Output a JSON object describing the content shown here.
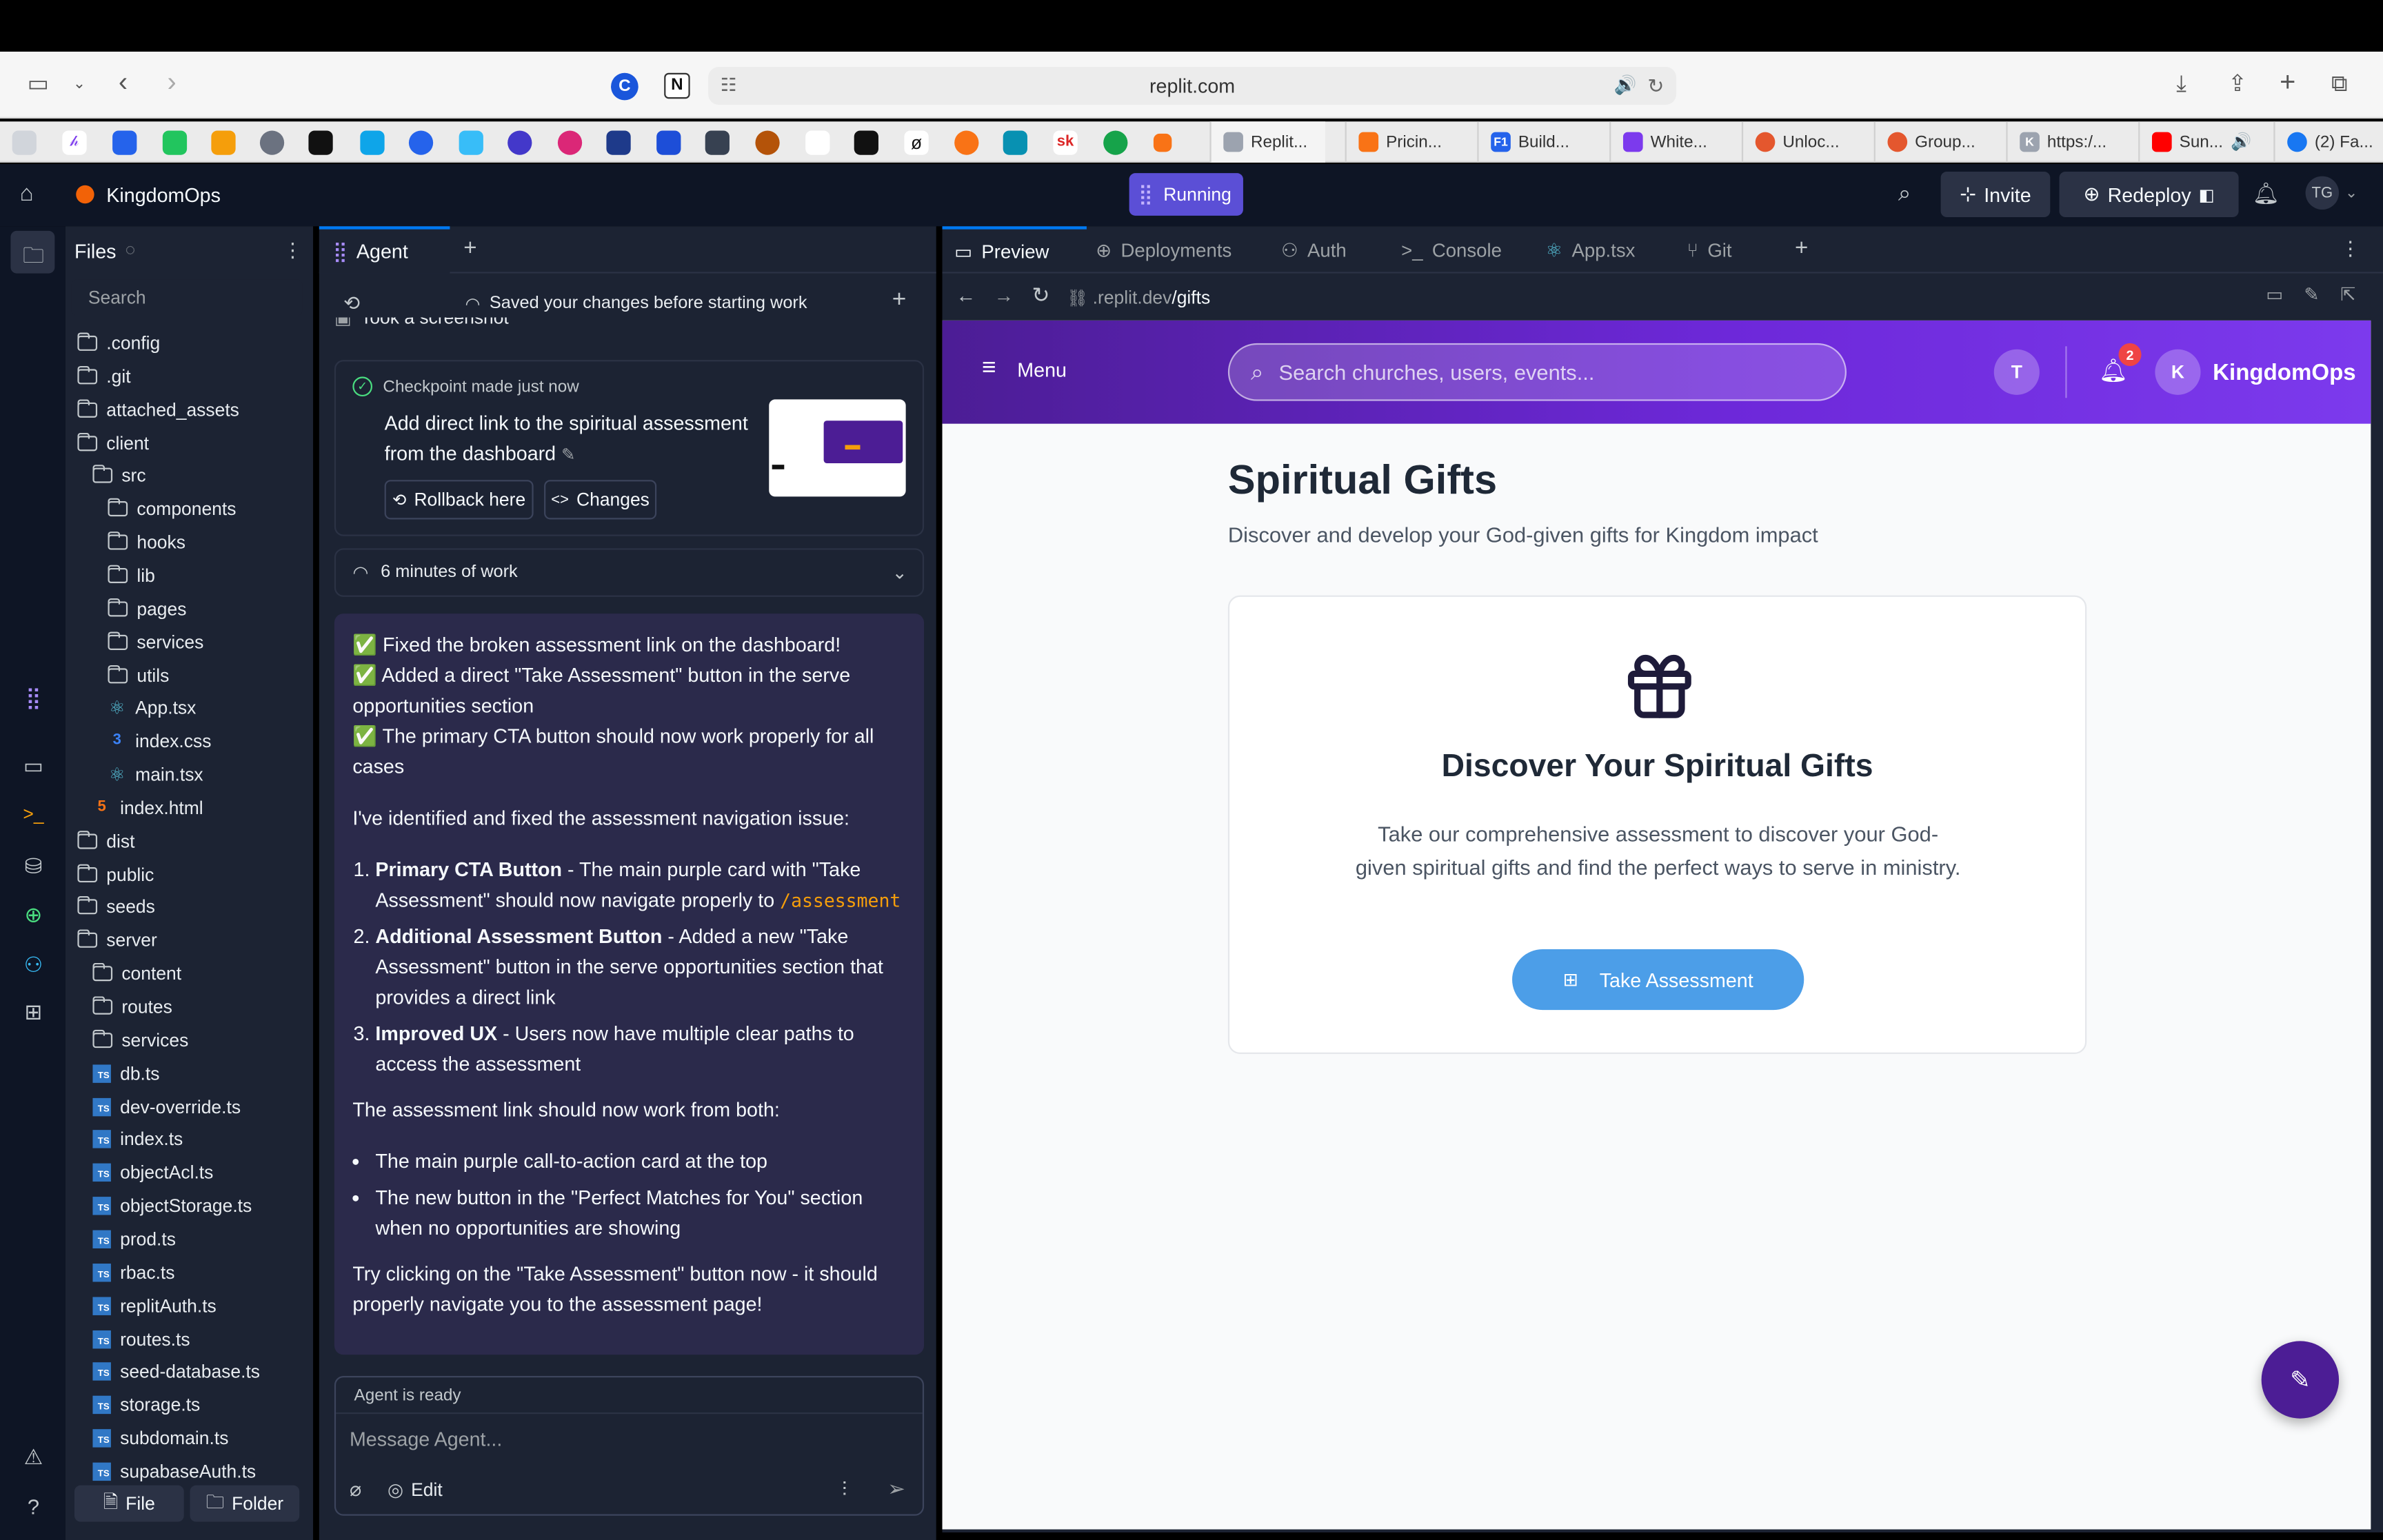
{
  "safari": {
    "url": "replit.com"
  },
  "tabs": [
    {
      "label": "Replit...",
      "color": "#f26207"
    },
    {
      "label": "Pricin...",
      "color": "#f97316"
    },
    {
      "label": "Build...",
      "color": "#2563eb",
      "glyph": "F1"
    },
    {
      "label": "White...",
      "color": "#7c3aed"
    },
    {
      "label": "Unloc...",
      "color": "#e4572e"
    },
    {
      "label": "Group...",
      "color": "#e4572e"
    },
    {
      "label": "https:/...",
      "color": "#9ca3af",
      "glyph": "K"
    },
    {
      "label": "Sun...",
      "color": "#ff0000"
    },
    {
      "label": "(2) Fa...",
      "color": "#1877f2"
    }
  ],
  "replit": {
    "project": "KingdomOps",
    "status": "Running",
    "invite": "Invite",
    "redeploy": "Redeploy",
    "avatar": "TG"
  },
  "files": {
    "title": "Files",
    "search_placeholder": "Search",
    "items": [
      {
        "name": ".config",
        "type": "folder",
        "indent": 0
      },
      {
        "name": ".git",
        "type": "folder",
        "indent": 0
      },
      {
        "name": "attached_assets",
        "type": "folder",
        "indent": 0
      },
      {
        "name": "client",
        "type": "folder",
        "indent": 0
      },
      {
        "name": "src",
        "type": "folder",
        "indent": 1
      },
      {
        "name": "components",
        "type": "folder",
        "indent": 2
      },
      {
        "name": "hooks",
        "type": "folder",
        "indent": 2
      },
      {
        "name": "lib",
        "type": "folder",
        "indent": 2
      },
      {
        "name": "pages",
        "type": "folder",
        "indent": 2
      },
      {
        "name": "services",
        "type": "folder",
        "indent": 2
      },
      {
        "name": "utils",
        "type": "folder",
        "indent": 2
      },
      {
        "name": "App.tsx",
        "type": "react",
        "indent": 2
      },
      {
        "name": "index.css",
        "type": "css",
        "indent": 2
      },
      {
        "name": "main.tsx",
        "type": "react",
        "indent": 2
      },
      {
        "name": "index.html",
        "type": "html",
        "indent": 1
      },
      {
        "name": "dist",
        "type": "folder",
        "indent": 0
      },
      {
        "name": "public",
        "type": "folder",
        "indent": 0
      },
      {
        "name": "seeds",
        "type": "folder",
        "indent": 0
      },
      {
        "name": "server",
        "type": "folder",
        "indent": 0
      },
      {
        "name": "content",
        "type": "folder",
        "indent": 1
      },
      {
        "name": "routes",
        "type": "folder",
        "indent": 1
      },
      {
        "name": "services",
        "type": "folder",
        "indent": 1
      },
      {
        "name": "db.ts",
        "type": "ts",
        "indent": 1
      },
      {
        "name": "dev-override.ts",
        "type": "ts",
        "indent": 1
      },
      {
        "name": "index.ts",
        "type": "ts",
        "indent": 1
      },
      {
        "name": "objectAcl.ts",
        "type": "ts",
        "indent": 1
      },
      {
        "name": "objectStorage.ts",
        "type": "ts",
        "indent": 1
      },
      {
        "name": "prod.ts",
        "type": "ts",
        "indent": 1
      },
      {
        "name": "rbac.ts",
        "type": "ts",
        "indent": 1
      },
      {
        "name": "replitAuth.ts",
        "type": "ts",
        "indent": 1
      },
      {
        "name": "routes.ts",
        "type": "ts",
        "indent": 1
      },
      {
        "name": "seed-database.ts",
        "type": "ts",
        "indent": 1
      },
      {
        "name": "storage.ts",
        "type": "ts",
        "indent": 1
      },
      {
        "name": "subdomain.ts",
        "type": "ts",
        "indent": 1
      },
      {
        "name": "supabaseAuth.ts",
        "type": "ts",
        "indent": 1
      }
    ],
    "new_file": "File",
    "new_folder": "Folder"
  },
  "agent": {
    "tab": "Agent",
    "saved_banner": "Saved your changes before starting work",
    "screenshot_line": "Took a screenshot",
    "checkpoint_label": "Checkpoint made just now",
    "checkpoint_title": "Add direct link to the spiritual assessment from the dashboard",
    "rollback": "Rollback here",
    "changes": "Changes",
    "work_time": "6 minutes of work",
    "checks": [
      "✅ Fixed the broken assessment link on the dashboard!",
      "✅ Added a direct \"Take Assessment\" button in the serve opportunities section",
      "✅ The primary CTA button should now work properly for all cases"
    ],
    "intro": "I've identified and fixed the assessment navigation issue:",
    "steps": [
      {
        "bold": "Primary CTA Button",
        "text": " - The main purple card with \"Take Assessment\" should now navigate properly to ",
        "code": "/assessment"
      },
      {
        "bold": "Additional Assessment Button",
        "text": " - Added a new \"Take Assessment\" button in the serve opportunities section that provides a direct link",
        "code": ""
      },
      {
        "bold": "Improved UX",
        "text": " - Users now have multiple clear paths to access the assessment",
        "code": ""
      }
    ],
    "both_line": "The assessment link should now work from both:",
    "bullets": [
      "The main purple call-to-action card at the top",
      "The new button in the \"Perfect Matches for You\" section when no opportunities are showing"
    ],
    "closing": "Try clicking on the \"Take Assessment\" button now - it should properly navigate you to the assessment page!",
    "ready": "Agent is ready",
    "input_placeholder": "Message Agent...",
    "edit": "Edit"
  },
  "preview": {
    "tabs": [
      "Preview",
      "Deployments",
      "Auth",
      "Console",
      "App.tsx",
      "Git"
    ],
    "url_host": ".replit.dev",
    "url_path": "/gifts"
  },
  "site": {
    "menu": "Menu",
    "search_placeholder": "Search churches, users, events...",
    "user_initial": "T",
    "notif_count": "2",
    "brand_initial": "K",
    "brand": "KingdomOps",
    "page_title": "Spiritual Gifts",
    "page_subtitle": "Discover and develop your God-given gifts for Kingdom impact",
    "card_title": "Discover Your Spiritual Gifts",
    "card_text": "Take our comprehensive assessment to discover your God-given spiritual gifts and find the perfect ways to serve in ministry.",
    "cta": "Take Assessment"
  },
  "colors": {
    "accent": "#7c3aed",
    "cta": "#4c9ee8",
    "replit_bg": "#0e1525",
    "panel": "#1c2333"
  }
}
